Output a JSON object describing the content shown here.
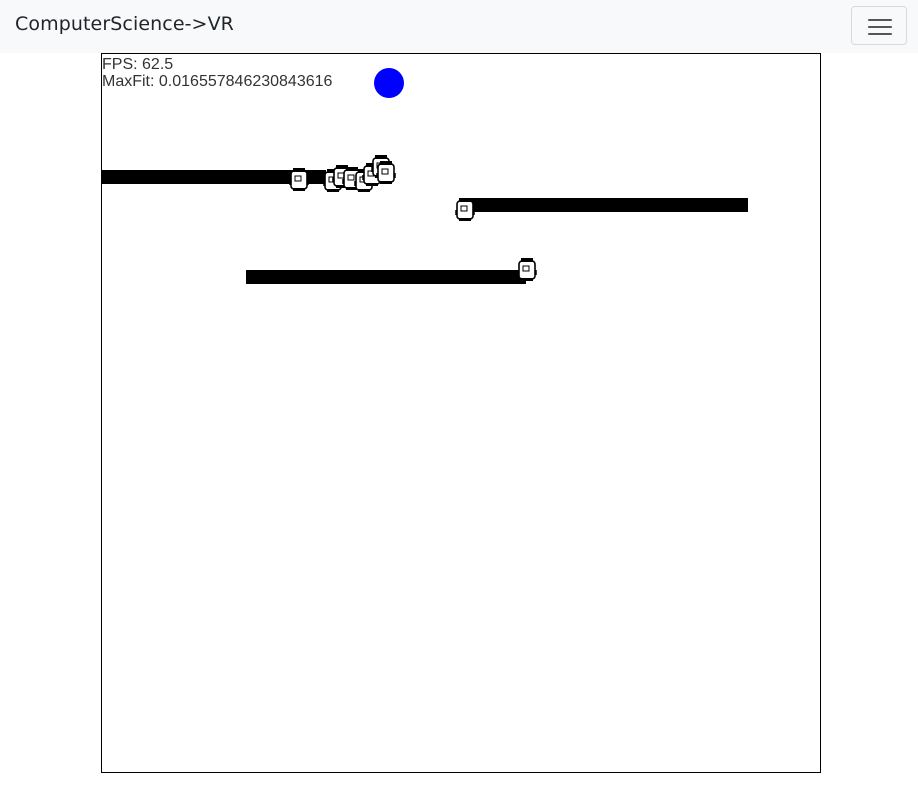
{
  "navbar": {
    "brand": "ComputerScience->VR",
    "toggler_icon": "hamburger-menu-icon"
  },
  "simulation": {
    "fps_label": "FPS:",
    "fps_value": "62.5",
    "maxfit_label": "MaxFit:",
    "maxfit_value": "0.016557846230843616",
    "target_color": "#0000ff",
    "wall_color": "#000000",
    "agent_icon": "robot-agent-icon"
  }
}
